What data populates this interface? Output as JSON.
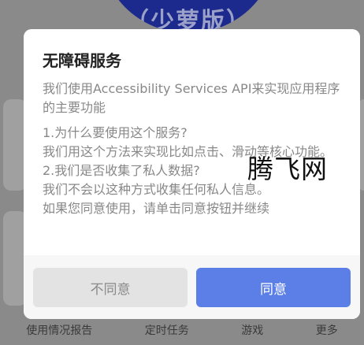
{
  "background": {
    "badge_text": "（少萝版）",
    "nav_items": [
      "使用情况报告",
      "定时任务",
      "游戏",
      "更多"
    ]
  },
  "dialog": {
    "title": "无障碍服务",
    "intro": "我们使用Accessibility Services API来实现应用程序的主要功能",
    "q1": "1.为什么要使用这个服务?",
    "a1": "我们用这个方法来实现比如点击、滑动等核心功能。",
    "q2": "2.我们是否收集了私人数据?",
    "a2": "我们不会以这种方式收集任何私人信息。",
    "note": "如果您同意使用，请单击同意按钮并继续",
    "decline_label": "不同意",
    "agree_label": "同意"
  },
  "watermark": "腾飞网",
  "colors": {
    "overlay": "#8a8a8a",
    "dialog_bg": "#ffffff",
    "agree_button": "#5b7fe6",
    "decline_button": "#e3e3e3",
    "body_text": "#888888"
  }
}
